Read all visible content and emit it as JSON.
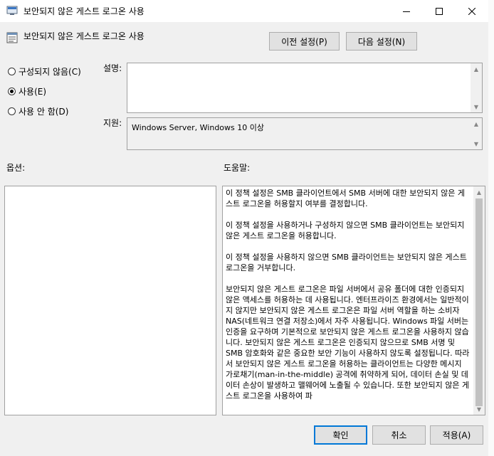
{
  "window": {
    "title": "보안되지 않은 게스트 로그온 사용",
    "subtitle": "보안되지 않은 게스트 로그온 사용"
  },
  "nav": {
    "prev_label": "이전 설정(P)",
    "next_label": "다음 설정(N)"
  },
  "state": {
    "options": [
      {
        "label": "구성되지 않음(C)",
        "selected": false
      },
      {
        "label": "사용(E)",
        "selected": true
      },
      {
        "label": "사용 안 함(D)",
        "selected": false
      }
    ]
  },
  "comment": {
    "label": "설명:",
    "value": ""
  },
  "supported": {
    "label": "지원:",
    "value": "Windows Server, Windows 10 이상"
  },
  "options_label": "옵션:",
  "help": {
    "label": "도움말:",
    "paragraphs": [
      "이 정책 설정은 SMB 클라이언트에서 SMB 서버에 대한 보안되지 않은 게스트 로그온을 허용할지 여부를 결정합니다.",
      "이 정책 설정을 사용하거나 구성하지 않으면 SMB 클라이언트는 보안되지 않은 게스트 로그온을 허용합니다.",
      "이 정책 설정을 사용하지 않으면 SMB 클라이언트는 보안되지 않은 게스트 로그온을 거부합니다.",
      "보안되지 않은 게스트 로그온은 파일 서버에서 공유 폴더에 대한 인증되지 않은 액세스를 허용하는 데 사용됩니다. 엔터프라이즈 환경에서는 일반적이지 않지만 보안되지 않은 게스트 로그온은 파일 서버 역할을 하는 소비자 NAS(네트워크 연결 저장소)에서 자주 사용됩니다. Windows 파일 서버는 인증을 요구하며 기본적으로 보안되지 않은 게스트 로그온을 사용하지 않습니다. 보안되지 않은 게스트 로그온은 인증되지 않으므로 SMB 서명 및 SMB 암호화와 같은 중요한 보안 기능이 사용하지 않도록 설정됩니다. 따라서 보안되지 않은 게스트 로그온을 허용하는 클라이언트는 다양한 메시지 가로채기(man-in-the-middle) 공격에 취약하게 되어, 데이터 손실 및 데이터 손상이 발생하고 맬웨어에 노출될 수 있습니다. 또한 보안되지 않은 게스트 로그온을 사용하여 파"
    ]
  },
  "buttons": {
    "ok": "확인",
    "cancel": "취소",
    "apply": "적용(A)"
  }
}
